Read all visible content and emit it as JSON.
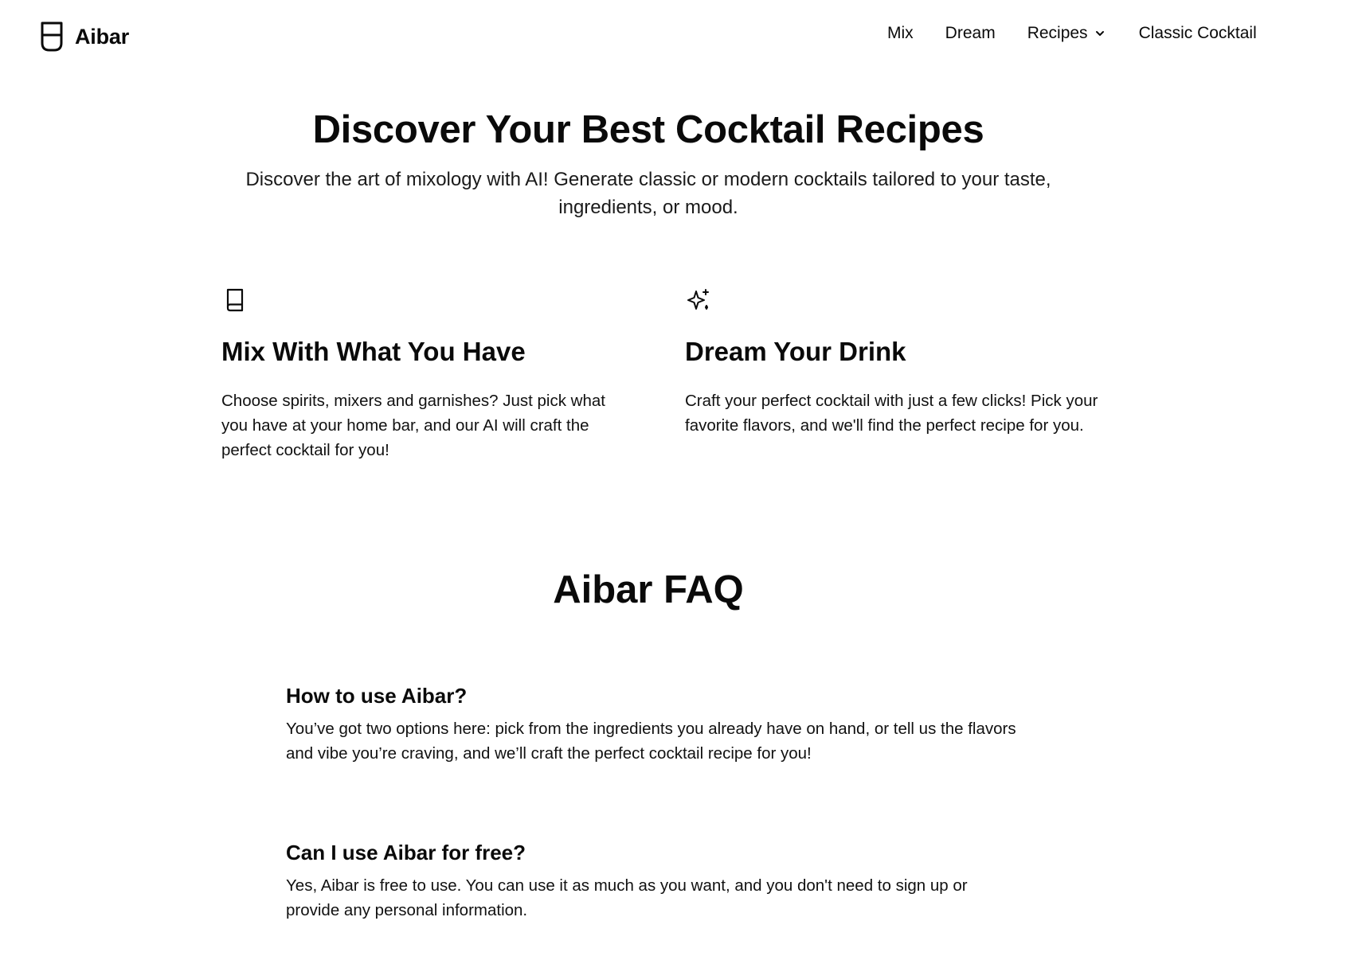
{
  "header": {
    "brand_name": "Aibar",
    "nav": {
      "mix": "Mix",
      "dream": "Dream",
      "recipes": "Recipes",
      "classic": "Classic Cocktail"
    }
  },
  "hero": {
    "title": "Discover Your Best Cocktail Recipes",
    "subtitle": "Discover the art of mixology with AI! Generate classic or modern cocktails tailored to your taste, ingredients, or mood."
  },
  "features": [
    {
      "icon": "book-icon",
      "title": "Mix With What You Have",
      "text": "Choose spirits, mixers and garnishes? Just pick what you have at your home bar, and our AI will craft the perfect cocktail for you!"
    },
    {
      "icon": "sparkles-icon",
      "title": "Dream Your Drink",
      "text": "Craft your perfect cocktail with just a few clicks! Pick your favorite flavors, and we'll find the perfect recipe for you."
    }
  ],
  "faq": {
    "title": "Aibar FAQ",
    "items": [
      {
        "question": "How to use Aibar?",
        "answer": "You’ve got two options here: pick from the ingredients you already have on hand, or tell us the flavors and vibe you’re craving, and we’ll craft the perfect cocktail recipe for you!"
      },
      {
        "question": "Can I use Aibar for free?",
        "answer": "Yes, Aibar is free to use. You can use it as much as you want, and you don't need to sign up or provide any personal information."
      }
    ]
  }
}
